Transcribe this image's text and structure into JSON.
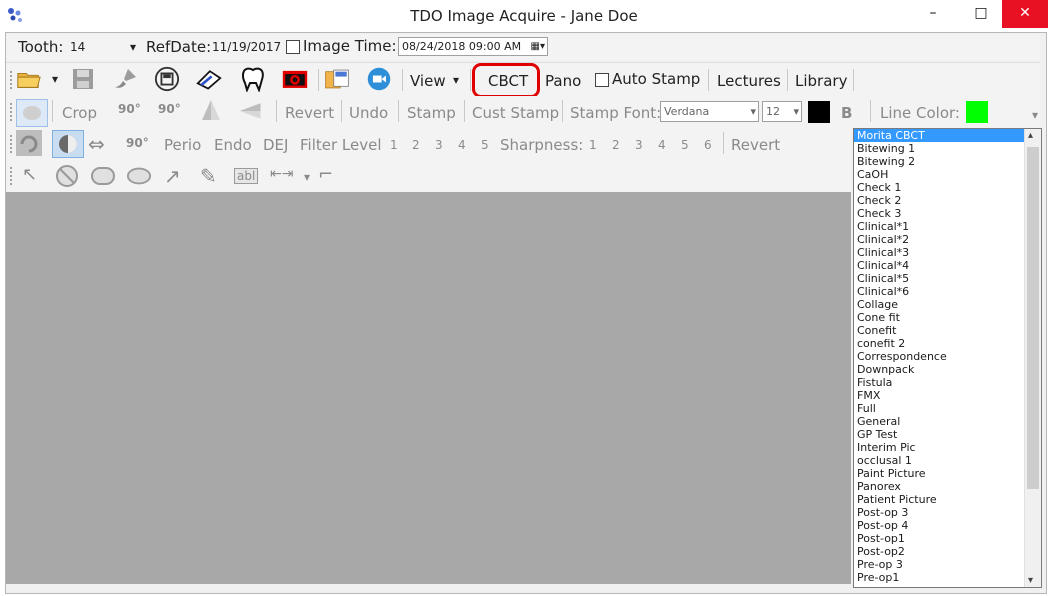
{
  "window": {
    "title": "TDO Image Acquire - Jane Doe",
    "minimize": "–",
    "maximize": "□",
    "close": "✕"
  },
  "row1": {
    "tooth_label": "Tooth:",
    "tooth_value": "14",
    "refdate_label": "RefDate:",
    "refdate_value": "11/19/2017",
    "image_time_label": "Image Time:",
    "image_time_value": "08/24/2018 09:00 AM"
  },
  "row2": {
    "view_label": "View",
    "cbct_label": "CBCT",
    "pano_label": "Pano",
    "auto_stamp_label": "Auto Stamp",
    "lectures_label": "Lectures",
    "library_label": "Library"
  },
  "row3": {
    "crop_label": "Crop",
    "rot90a": "90°",
    "rot90b": "90°",
    "revert_label": "Revert",
    "undo_label": "Undo",
    "stamp_label": "Stamp",
    "cust_stamp_label": "Cust Stamp",
    "stamp_font_label": "Stamp Font:",
    "font_value": "Verdana",
    "size_value": "12",
    "bold_label": "B",
    "line_color_label": "Line Color:",
    "stamp_color": "#000000",
    "line_color": "#00ff00"
  },
  "row4": {
    "rot90": "90°",
    "perio_label": "Perio",
    "endo_label": "Endo",
    "dej_label": "DEJ",
    "filter_label": "Filter Level",
    "filter_levels": [
      "1",
      "2",
      "3",
      "4",
      "5"
    ],
    "sharpness_label": "Sharpness:",
    "sharpness_levels": [
      "1",
      "2",
      "3",
      "4",
      "5",
      "6"
    ],
    "revert_label": "Revert"
  },
  "row5": {
    "text_tool": "abl"
  },
  "list": {
    "items": [
      "Morita CBCT",
      "Bitewing 1",
      "Bitewing 2",
      "CaOH",
      "Check 1",
      "Check 2",
      "Check 3",
      "Clinical*1",
      "Clinical*2",
      "Clinical*3",
      "Clinical*4",
      "Clinical*5",
      "Clinical*6",
      "Collage",
      "Cone fit",
      "Conefit",
      "conefit 2",
      "Correspondence",
      "Downpack",
      "Fistula",
      "FMX",
      "Full",
      "General",
      "GP Test",
      "Interim Pic",
      "occlusal 1",
      "Paint Picture",
      "Panorex",
      "Patient Picture",
      "Post-op 3",
      "Post-op 4",
      "Post-op1",
      "Post-op2",
      "Pre-op 3",
      "Pre-op1"
    ],
    "selected": "Morita CBCT"
  }
}
